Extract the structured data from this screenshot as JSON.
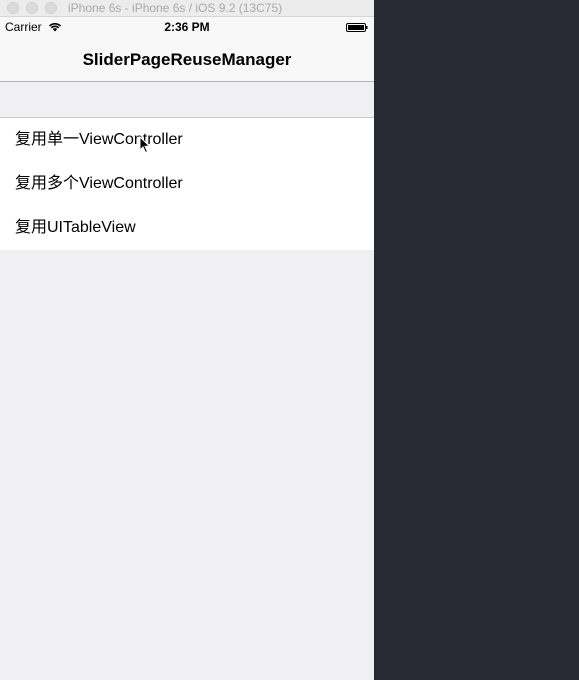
{
  "window": {
    "title": "iPhone 6s - iPhone 6s / iOS 9.2 (13C75)"
  },
  "statusbar": {
    "carrier": "Carrier",
    "time": "2:36 PM",
    "wifi_icon": "wifi-icon",
    "battery_icon": "battery-icon"
  },
  "navbar": {
    "title": "SliderPageReuseManager"
  },
  "table": {
    "rows": [
      {
        "label": "复用单一ViewController"
      },
      {
        "label": "复用多个ViewController"
      },
      {
        "label": "复用UITableView"
      }
    ]
  },
  "colors": {
    "background": "#efeff4",
    "desktop": "#282a33",
    "bar": "#f8f8f8"
  }
}
